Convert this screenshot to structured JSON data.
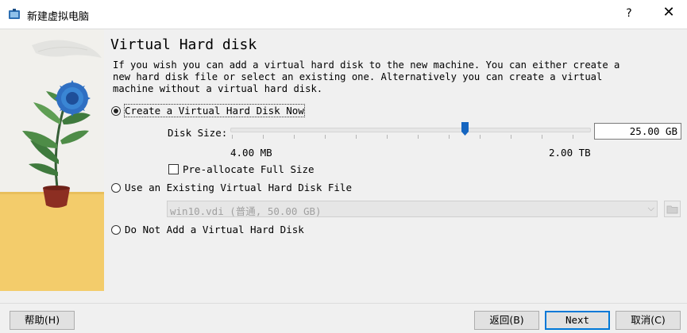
{
  "window": {
    "title": "新建虚拟电脑",
    "help_label": "?",
    "close_label": "✕"
  },
  "page": {
    "title": "Virtual Hard disk",
    "description": "If you wish you can add a virtual hard disk to the new machine. You can either create a new hard disk file or select an existing one. Alternatively you can create a virtual machine without a virtual hard disk."
  },
  "options": {
    "create_now": {
      "label": "Create a Virtual Hard Disk Now",
      "selected": true
    },
    "use_existing": {
      "label": "Use an Existing Virtual Hard Disk File",
      "selected": false
    },
    "no_disk": {
      "label": "Do Not Add a Virtual Hard Disk",
      "selected": false
    }
  },
  "disk_size": {
    "label": "Disk Size:",
    "value": "25.00 GB",
    "min_label": "4.00 MB",
    "max_label": "2.00 TB",
    "slider_fraction": 0.65
  },
  "preallocate": {
    "label": "Pre-allocate Full Size",
    "checked": false
  },
  "existing_file": {
    "value": "win10.vdi (普通, 50.00 GB)",
    "enabled": false
  },
  "buttons": {
    "help": "帮助(H)",
    "back": "返回(B)",
    "next": "Next",
    "cancel": "取消(C)"
  },
  "colors": {
    "accent": "#0078d7",
    "slider_handle": "#1565c0",
    "panel_yellow": "#f3cc6b"
  }
}
